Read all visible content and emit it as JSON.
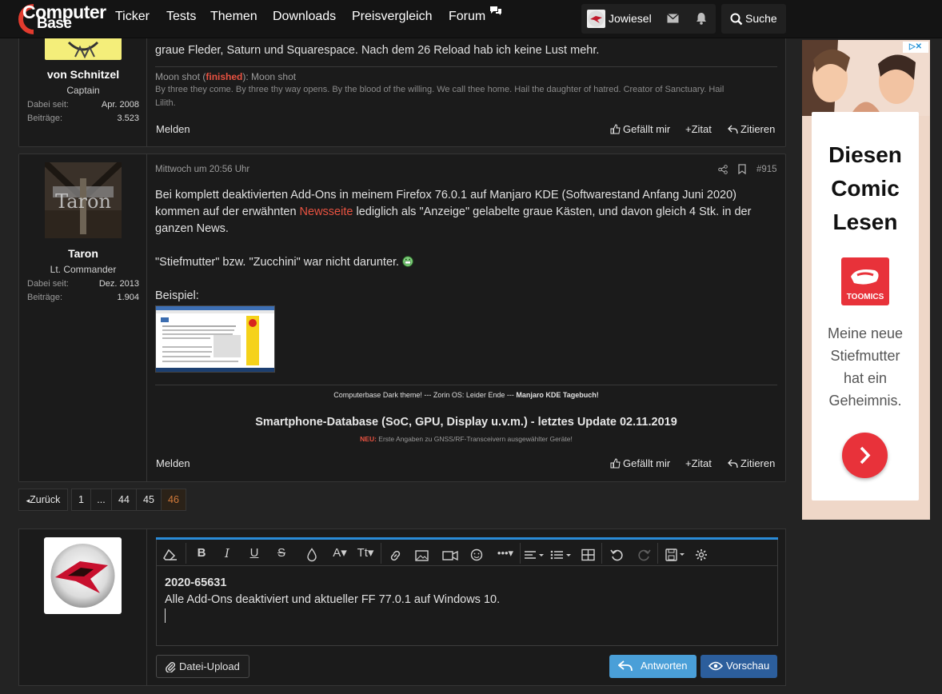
{
  "nav": {
    "logo_line1": "Computer",
    "logo_line2": "Base",
    "items": [
      "Ticker",
      "Tests",
      "Themen",
      "Downloads",
      "Preisvergleich",
      "Forum"
    ],
    "username": "Jowiesel",
    "search_label": "Suche"
  },
  "post1": {
    "author": "von Schnitzel",
    "rank": "Captain",
    "joined_label": "Dabei seit:",
    "joined": "Apr. 2008",
    "posts_label": "Beiträge:",
    "posts": "3.523",
    "text_tail": "graue Fleder, Saturn und Squarespace. Nach dem 26 Reload hab ich keine Lust mehr.",
    "sig_prefix": "Moon shot (",
    "sig_finished": "finished",
    "sig_suffix": "): Moon shot",
    "sig_line1": "By three they come. By three thy way opens. By the blood of the willing. We call thee home. Hail the daughter of hatred. Creator of Sanctuary. Hail",
    "sig_line2": "Lilith.",
    "report": "Melden",
    "like": "Gefällt mir",
    "quote": "Zitat",
    "reply": "Zitieren"
  },
  "post2": {
    "author": "Taron",
    "rank": "Lt. Commander",
    "joined_label": "Dabei seit:",
    "joined": "Dez. 2013",
    "posts_label": "Beiträge:",
    "posts": "1.904",
    "timestamp": "Mittwoch um 20:56 Uhr",
    "post_number": "#915",
    "line1": "Bei komplett deaktivierten Add-Ons in meinem Firefox 76.0.1 auf Manjaro KDE (Softwarestand Anfang Juni 2020)",
    "line2_pre": "kommen auf der erwähnten ",
    "line2_link": "Newsseite",
    "line2_post": " lediglich als \"Anzeige\" gelabelte graue Kästen, und davon gleich 4 Stk. in der",
    "line3": "ganzen News.",
    "line4": "\"Stiefmutter\" bzw. \"Zucchini\" war nicht darunter.",
    "example_label": "Beispiel:",
    "sig1_pre": "Computerbase Dark theme! --- Zorin OS: Leider Ende --- ",
    "sig1_bold": "Manjaro KDE Tagebuch!",
    "sig2": "Smartphone-Database (SoC, GPU, Display u.v.m.) - letztes Update 02.11.2019",
    "sig3_new": "NEU:",
    "sig3": " Erste Angaben zu GNSS/RF-Transceivern ausgewählter Geräte!",
    "report": "Melden",
    "like": "Gefällt mir",
    "quote": "Zitat",
    "reply": "Zitieren"
  },
  "pagination": {
    "prev": "Zurück",
    "pages": [
      "1",
      "...",
      "44",
      "45",
      "46"
    ],
    "current": "46"
  },
  "editor": {
    "line1": "2020-65631",
    "line2": "Alle Add-Ons deaktiviert und aktueller FF 77.0.1 auf Windows 10.",
    "upload": "Datei-Upload",
    "submit": "Antworten",
    "preview": "Vorschau"
  },
  "ad": {
    "headline1": "Diesen",
    "headline2": "Comic",
    "headline3": "Lesen",
    "brand": "TOOMICS",
    "sub1": "Meine neue",
    "sub2": "Stiefmutter",
    "sub3": "hat ein",
    "sub4": "Geheimnis."
  },
  "colors": {
    "accent_blue": "#2a8bd8",
    "link_red": "#e85241",
    "ad_red": "#e8323a"
  }
}
